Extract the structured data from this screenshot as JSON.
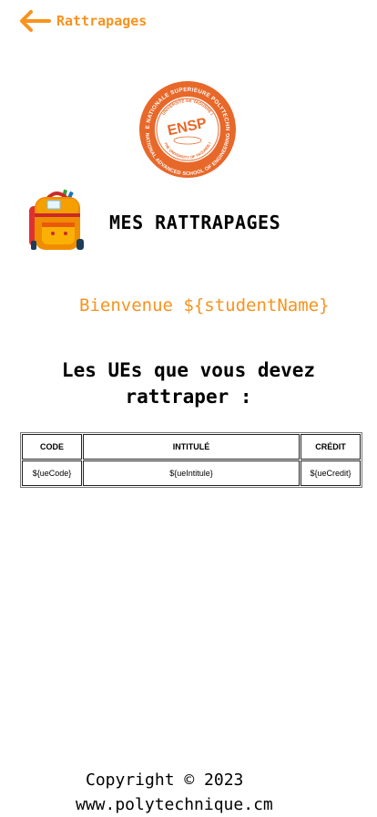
{
  "header": {
    "back_label": "Rattrapages",
    "back_icon": "arrow-left-icon",
    "accent_color": "#f7931e"
  },
  "logo": {
    "name": "ENSP",
    "outer_text": "ECOLE NATIONALE SUPERIEURE POLYTECHNIQUE",
    "inner_text": "UNIVERSITE DE YAOUNDE I",
    "bottom_text": "NATIONAL ADVANCED SCHOOL OF ENGINEERING",
    "inner_bottom_text": "THE UNIVERSITY OF YAOUNDE I"
  },
  "page": {
    "title": "MES RATTRAPAGES",
    "icon": "backpack-icon",
    "welcome": "Bienvenue ${studentName}",
    "section_title": "Les UEs que vous devez rattraper :"
  },
  "table": {
    "headers": {
      "code": "CODE",
      "intitule": "INTITULÉ",
      "credit": "CRÉDIT"
    },
    "rows": [
      {
        "code": "${ueCode}",
        "intitule": "${ueIntitule}",
        "credit": "${ueCredit}"
      }
    ]
  },
  "footer": {
    "copyright": "Copyright © 2023",
    "website": "www.polytechnique.cm"
  }
}
